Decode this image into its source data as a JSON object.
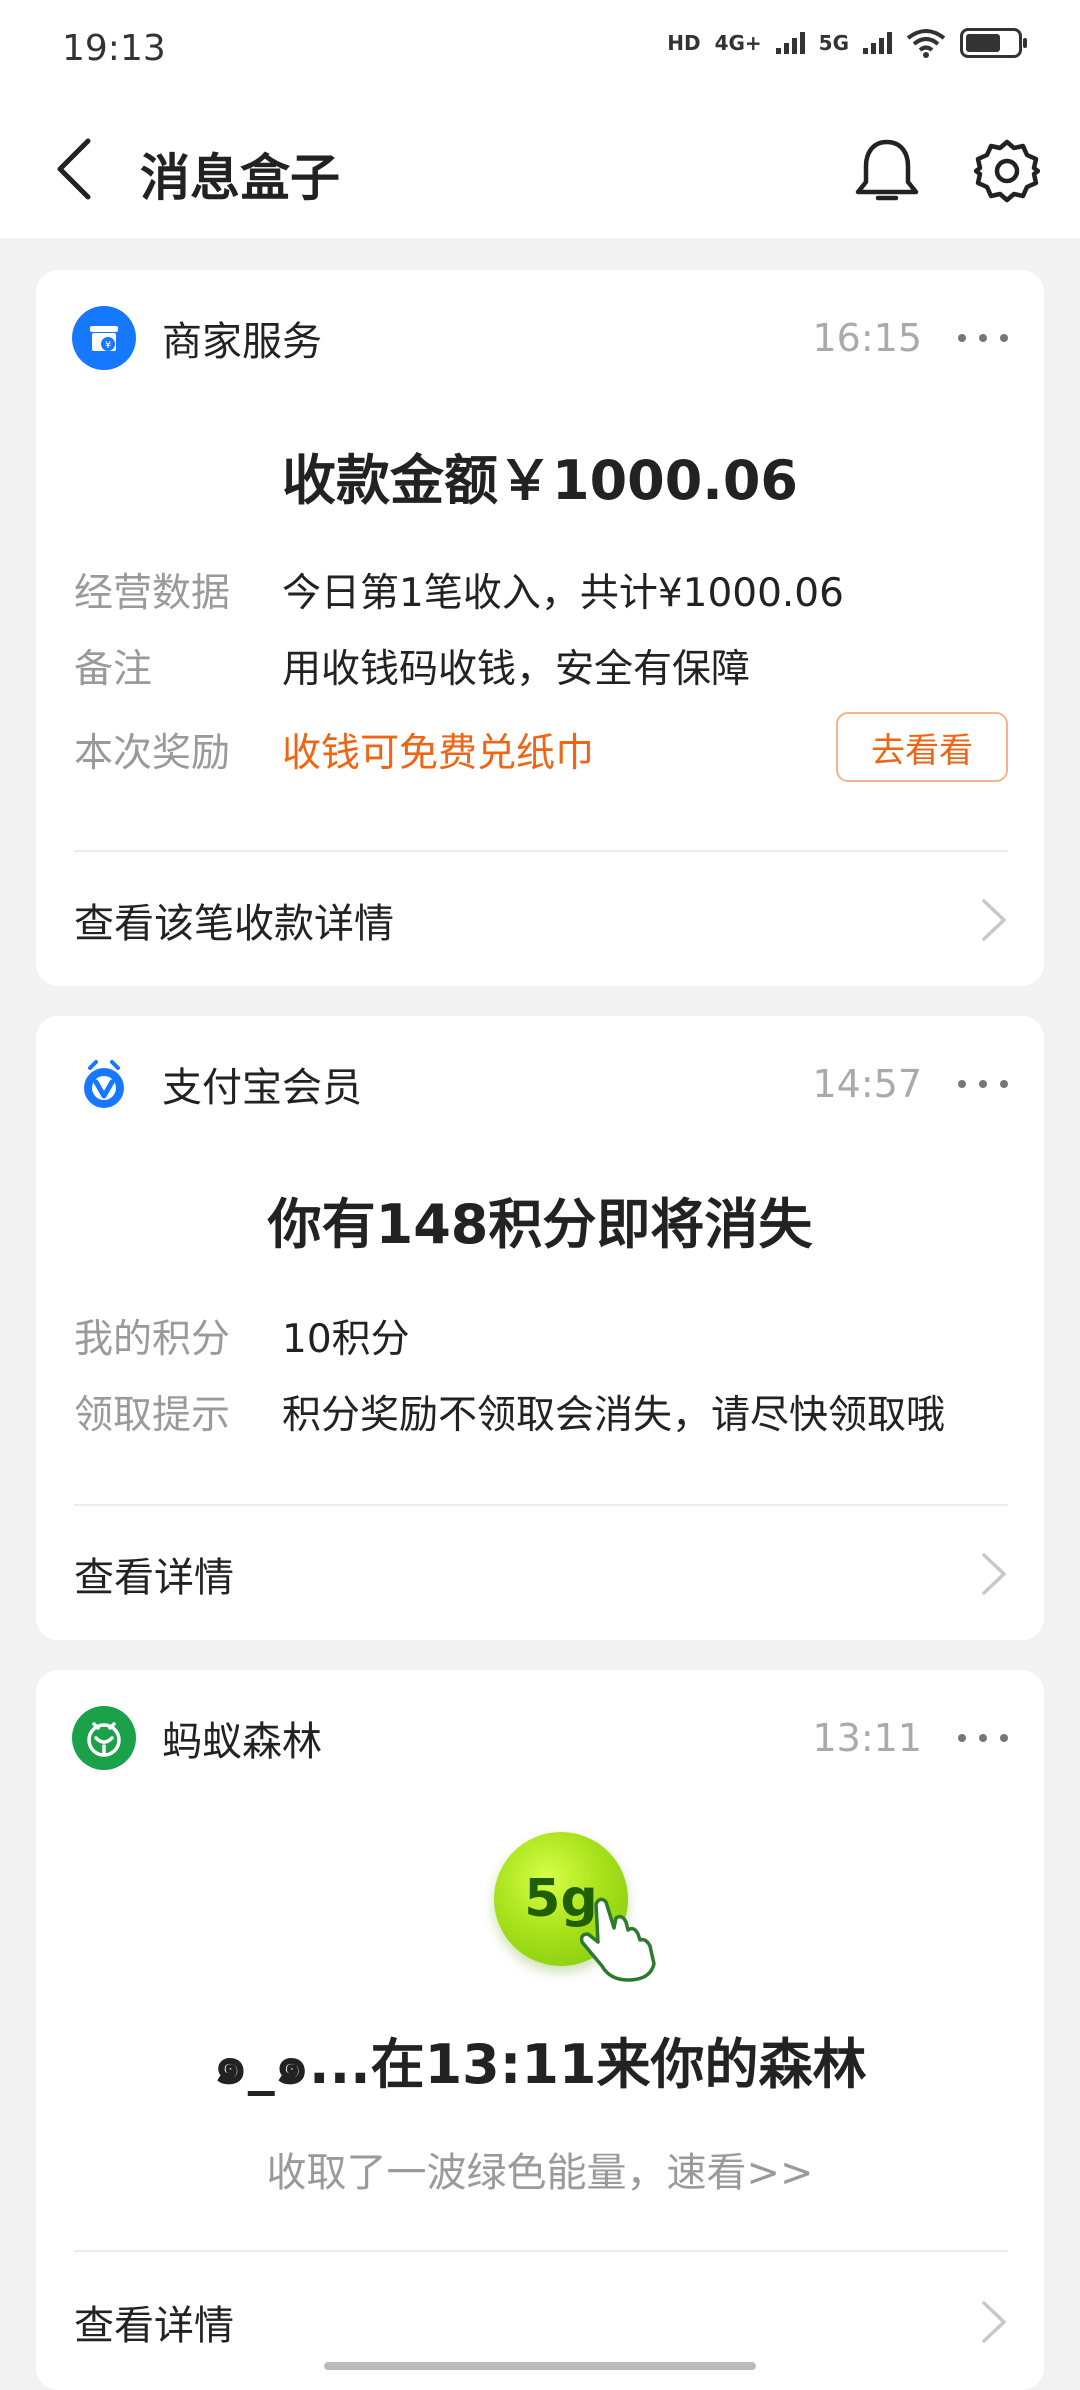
{
  "status_bar": {
    "time": "19:13",
    "network_1": "HD",
    "network_2": "4G+",
    "network_3": "5G"
  },
  "header": {
    "title": "消息盒子"
  },
  "cards": [
    {
      "app_name": "商家服务",
      "time": "16:15",
      "headline": "收款金额￥1000.06",
      "rows": [
        {
          "key": "经营数据",
          "value": "今日第1笔收入，共计¥1000.06"
        },
        {
          "key": "备注",
          "value": "用收钱码收钱，安全有保障"
        },
        {
          "key": "本次奖励",
          "value": "收钱可免费兑纸巾"
        }
      ],
      "action_label": "去看看",
      "footer_link": "查看该笔收款详情",
      "icon_color": "#1677ff"
    },
    {
      "app_name": "支付宝会员",
      "time": "14:57",
      "headline": "你有148积分即将消失",
      "rows": [
        {
          "key": "我的积分",
          "value": "10积分"
        },
        {
          "key": "领取提示",
          "value": "积分奖励不领取会消失，请尽快领取哦"
        }
      ],
      "footer_link": "查看详情",
      "icon_color": "#1677ff"
    },
    {
      "app_name": "蚂蚁森林",
      "time": "13:11",
      "energy_label": "5g",
      "headline": "๑_๑...在13:11来你的森林",
      "subtext": "收取了一波绿色能量，速看>>",
      "footer_link": "查看详情",
      "icon_color": "#1aa14a"
    }
  ],
  "colors": {
    "accent_orange": "#f06514",
    "muted_text": "#9a9a9a",
    "background": "#f2f2f2"
  }
}
